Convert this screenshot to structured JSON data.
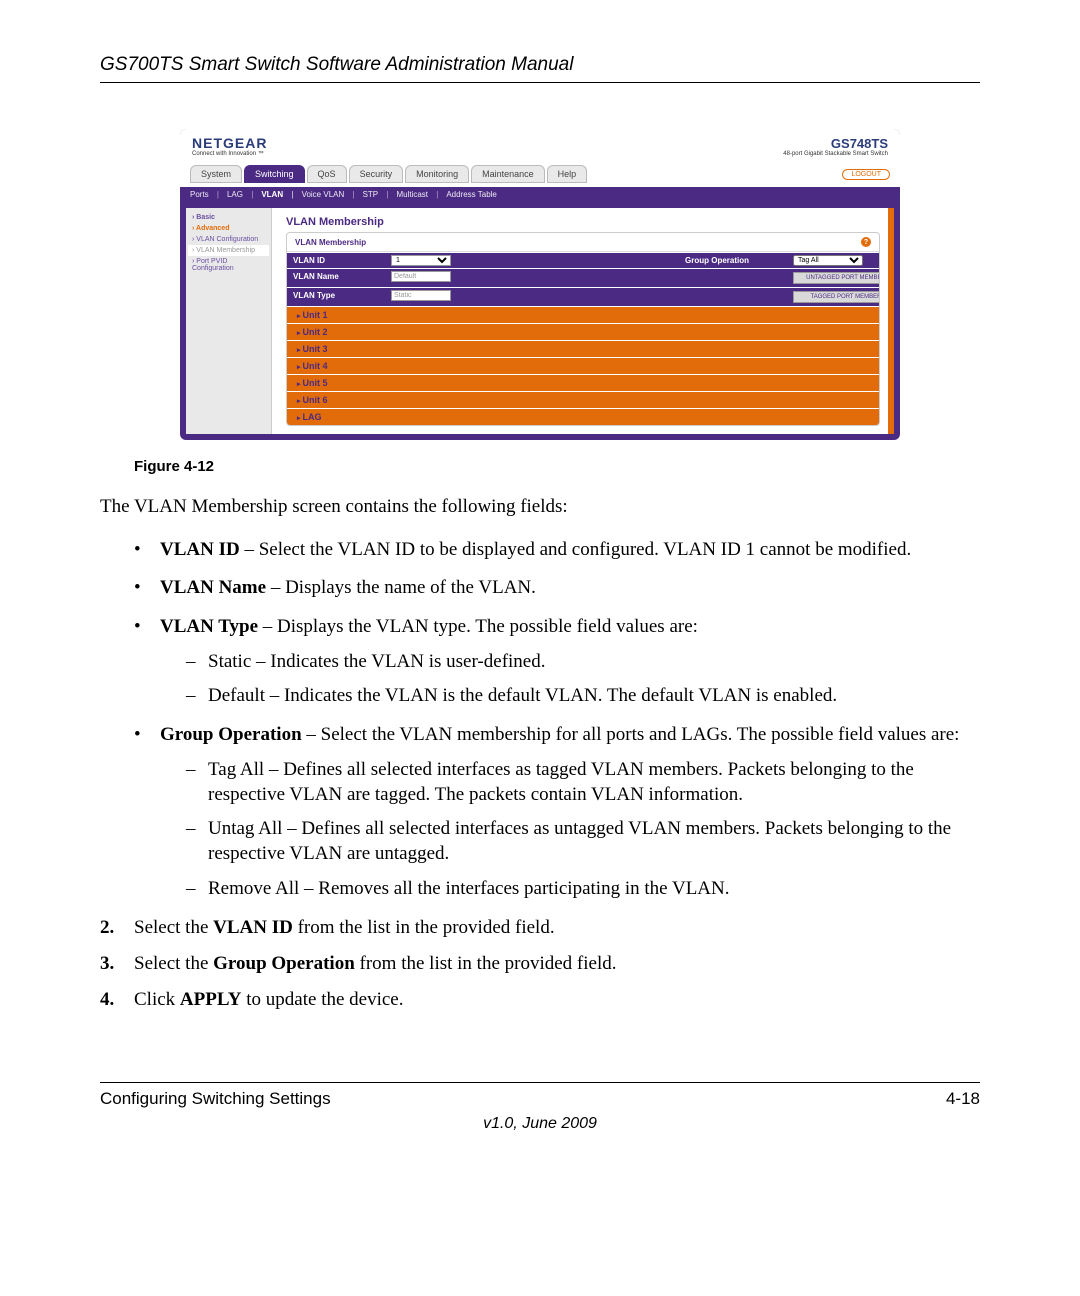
{
  "doc": {
    "header_title": "GS700TS Smart Switch Software Administration Manual",
    "footer_left": "Configuring Switching Settings",
    "footer_right": "4-18",
    "version": "v1.0, June 2009",
    "figure_caption": "Figure 4-12",
    "intro": "The VLAN Membership screen contains the following fields:"
  },
  "bullets": {
    "vlan_id_b": "VLAN ID",
    "vlan_id_t": " – Select the VLAN ID to be displayed and configured. VLAN ID 1 cannot be modified.",
    "vlan_name_b": "VLAN Name",
    "vlan_name_t": " – Displays the name of the VLAN.",
    "vlan_type_b": "VLAN Type",
    "vlan_type_t": " – Displays the VLAN type. The possible field values are:",
    "type_static": "Static – Indicates the VLAN is user-defined.",
    "type_default": "Default – Indicates the VLAN is the default VLAN. The default VLAN is enabled.",
    "group_op_b": "Group Operation",
    "group_op_t": " – Select the VLAN membership for all ports and LAGs. The possible field values are:",
    "tag_all": "Tag All – Defines all selected interfaces as tagged VLAN members. Packets belonging to the respective VLAN are tagged. The packets contain VLAN information.",
    "untag_all": "Untag All – Defines all selected interfaces as untagged VLAN members. Packets belonging to the respective VLAN are untagged.",
    "remove_all": "Remove All – Removes all the interfaces participating in the VLAN."
  },
  "steps": {
    "s2_num": "2.",
    "s2_a": "Select the ",
    "s2_b": "VLAN ID",
    "s2_c": " from the list in the provided field.",
    "s3_num": "3.",
    "s3_a": "Select the ",
    "s3_b": "Group Operation",
    "s3_c": " from the list in the provided field.",
    "s4_num": "4.",
    "s4_a": "Click ",
    "s4_b": "APPLY",
    "s4_c": " to update the device."
  },
  "app": {
    "brand": "NETGEAR",
    "tagline": "Connect with Innovation ™",
    "model": "GS748TS",
    "model_sub": "48-port Gigabit Stackable Smart Switch",
    "logout": "LOGOUT",
    "tabs": [
      "System",
      "Switching",
      "QoS",
      "Security",
      "Monitoring",
      "Maintenance",
      "Help"
    ],
    "active_tab": "Switching",
    "subnav": [
      "Ports",
      "LAG",
      "VLAN",
      "Voice VLAN",
      "STP",
      "Multicast",
      "Address Table"
    ],
    "subnav_active": "VLAN",
    "sidebar": {
      "basic": "› Basic",
      "adv": "› Advanced",
      "vlan_conf": "› VLAN Configuration",
      "vlan_mem": "› VLAN Membership",
      "pvid": "› Port PVID Configuration"
    },
    "panel_title": "VLAN Membership",
    "box_title": "VLAN Membership",
    "labels": {
      "vlan_id": "VLAN ID",
      "vlan_name": "VLAN Name",
      "vlan_type": "VLAN Type",
      "group_op": "Group Operation"
    },
    "values": {
      "vlan_id": "1",
      "vlan_name": "Default",
      "vlan_type": "Static",
      "group_op": "Tag All"
    },
    "buttons": {
      "untagged": "UNTAGGED PORT MEMBERS",
      "tagged": "TAGGED PORT MEMBERS"
    },
    "units": [
      "Unit 1",
      "Unit 2",
      "Unit 3",
      "Unit 4",
      "Unit 5",
      "Unit 6",
      "LAG"
    ]
  }
}
